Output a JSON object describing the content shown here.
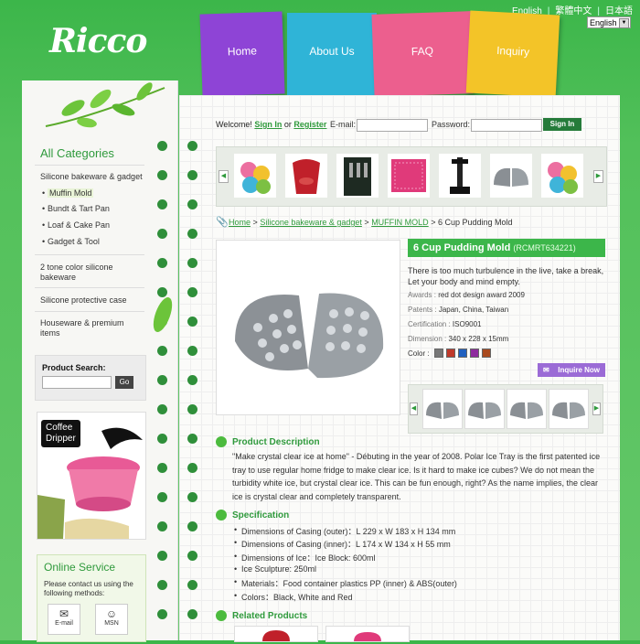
{
  "header": {
    "logo_text": "Ricco",
    "lang_links": [
      "English",
      "繁體中文",
      "日本語"
    ],
    "lang_select": "English",
    "nav": [
      {
        "label": "Home",
        "color": "#8e44d6"
      },
      {
        "label": "About Us",
        "color": "#2fb4d7"
      },
      {
        "label": "FAQ",
        "color": "#ec5f8e"
      },
      {
        "label": "Inquiry",
        "color": "#f3c428"
      }
    ]
  },
  "sidebar": {
    "title": "All Categories",
    "categories": [
      "Silicone bakeware & gadget",
      "2 tone color silicone bakeware",
      "Silicone protective case",
      "Houseware & premium items"
    ],
    "subcategories": [
      "Muffin Mold",
      "Bundt & Tart Pan",
      "Loaf & Cake Pan",
      "Gadget & Tool"
    ],
    "search": {
      "label": "Product Search:",
      "button": "Go"
    },
    "ad_text_1": "Coffee",
    "ad_text_2": "Dripper",
    "online": {
      "title": "Online Service",
      "text": "Please contact us using the following methods:",
      "methods": [
        "E-mail",
        "MSN"
      ]
    }
  },
  "login": {
    "welcome": "Welcome!",
    "signin_link": "Sign In",
    "or": "or",
    "register_link": "Register",
    "email_label": "E-mail:",
    "password_label": "Password:",
    "button": "Sign In"
  },
  "breadcrumb": {
    "home": "Home",
    "sep": ">",
    "cat": "Silicone bakeware & gadget",
    "sub": "MUFFIN MOLD",
    "current": "6 Cup Pudding Mold"
  },
  "product": {
    "title": "6 Cup Pudding Mold",
    "code": "(RCMRT634221)",
    "description": "There is too much turbulence in the live, take a break, Let your body and mind empty.",
    "awards_label": "Awards :",
    "awards": "red dot design award 2009",
    "patents_label": "Patents :",
    "patents": "Japan, China, Taiwan",
    "cert_label": "Certification :",
    "cert": "ISO9001",
    "dim_label": "Dimension :",
    "dim": "340 x 228 x 15mm",
    "color_label": "Color :",
    "colors": [
      "#777777",
      "#c0392b",
      "#1f5fbf",
      "#8e2a9e",
      "#a94a1e"
    ],
    "inquire": "Inquire Now"
  },
  "sections": {
    "description_head": "Product Description",
    "description_text": "\"Make crystal clear ice at home\" - Débuting in the year of 2008. Polar Ice Tray is the first patented ice tray to use regular home fridge to make clear ice. Is it hard to make ice cubes? We do not mean the turbidity white ice, but crystal clear ice. This can be fun enough, right? As the name implies, the clear ice is crystal clear and completely transparent.",
    "spec_head": "Specification",
    "specs": [
      "Dimensions of Casing (outer)：L 229 x W 183 x H 134 mm",
      "Dimensions of Casing (inner)：L 174 x W 134 x H 55 mm",
      "Dimensions of Ice：Ice Block: 600ml",
      "Ice Sculpture: 250ml",
      "Materials：Food container plastics PP (inner) & ABS(outer)",
      "Colors：Black, White and Red"
    ],
    "related_head": "Related Products"
  }
}
